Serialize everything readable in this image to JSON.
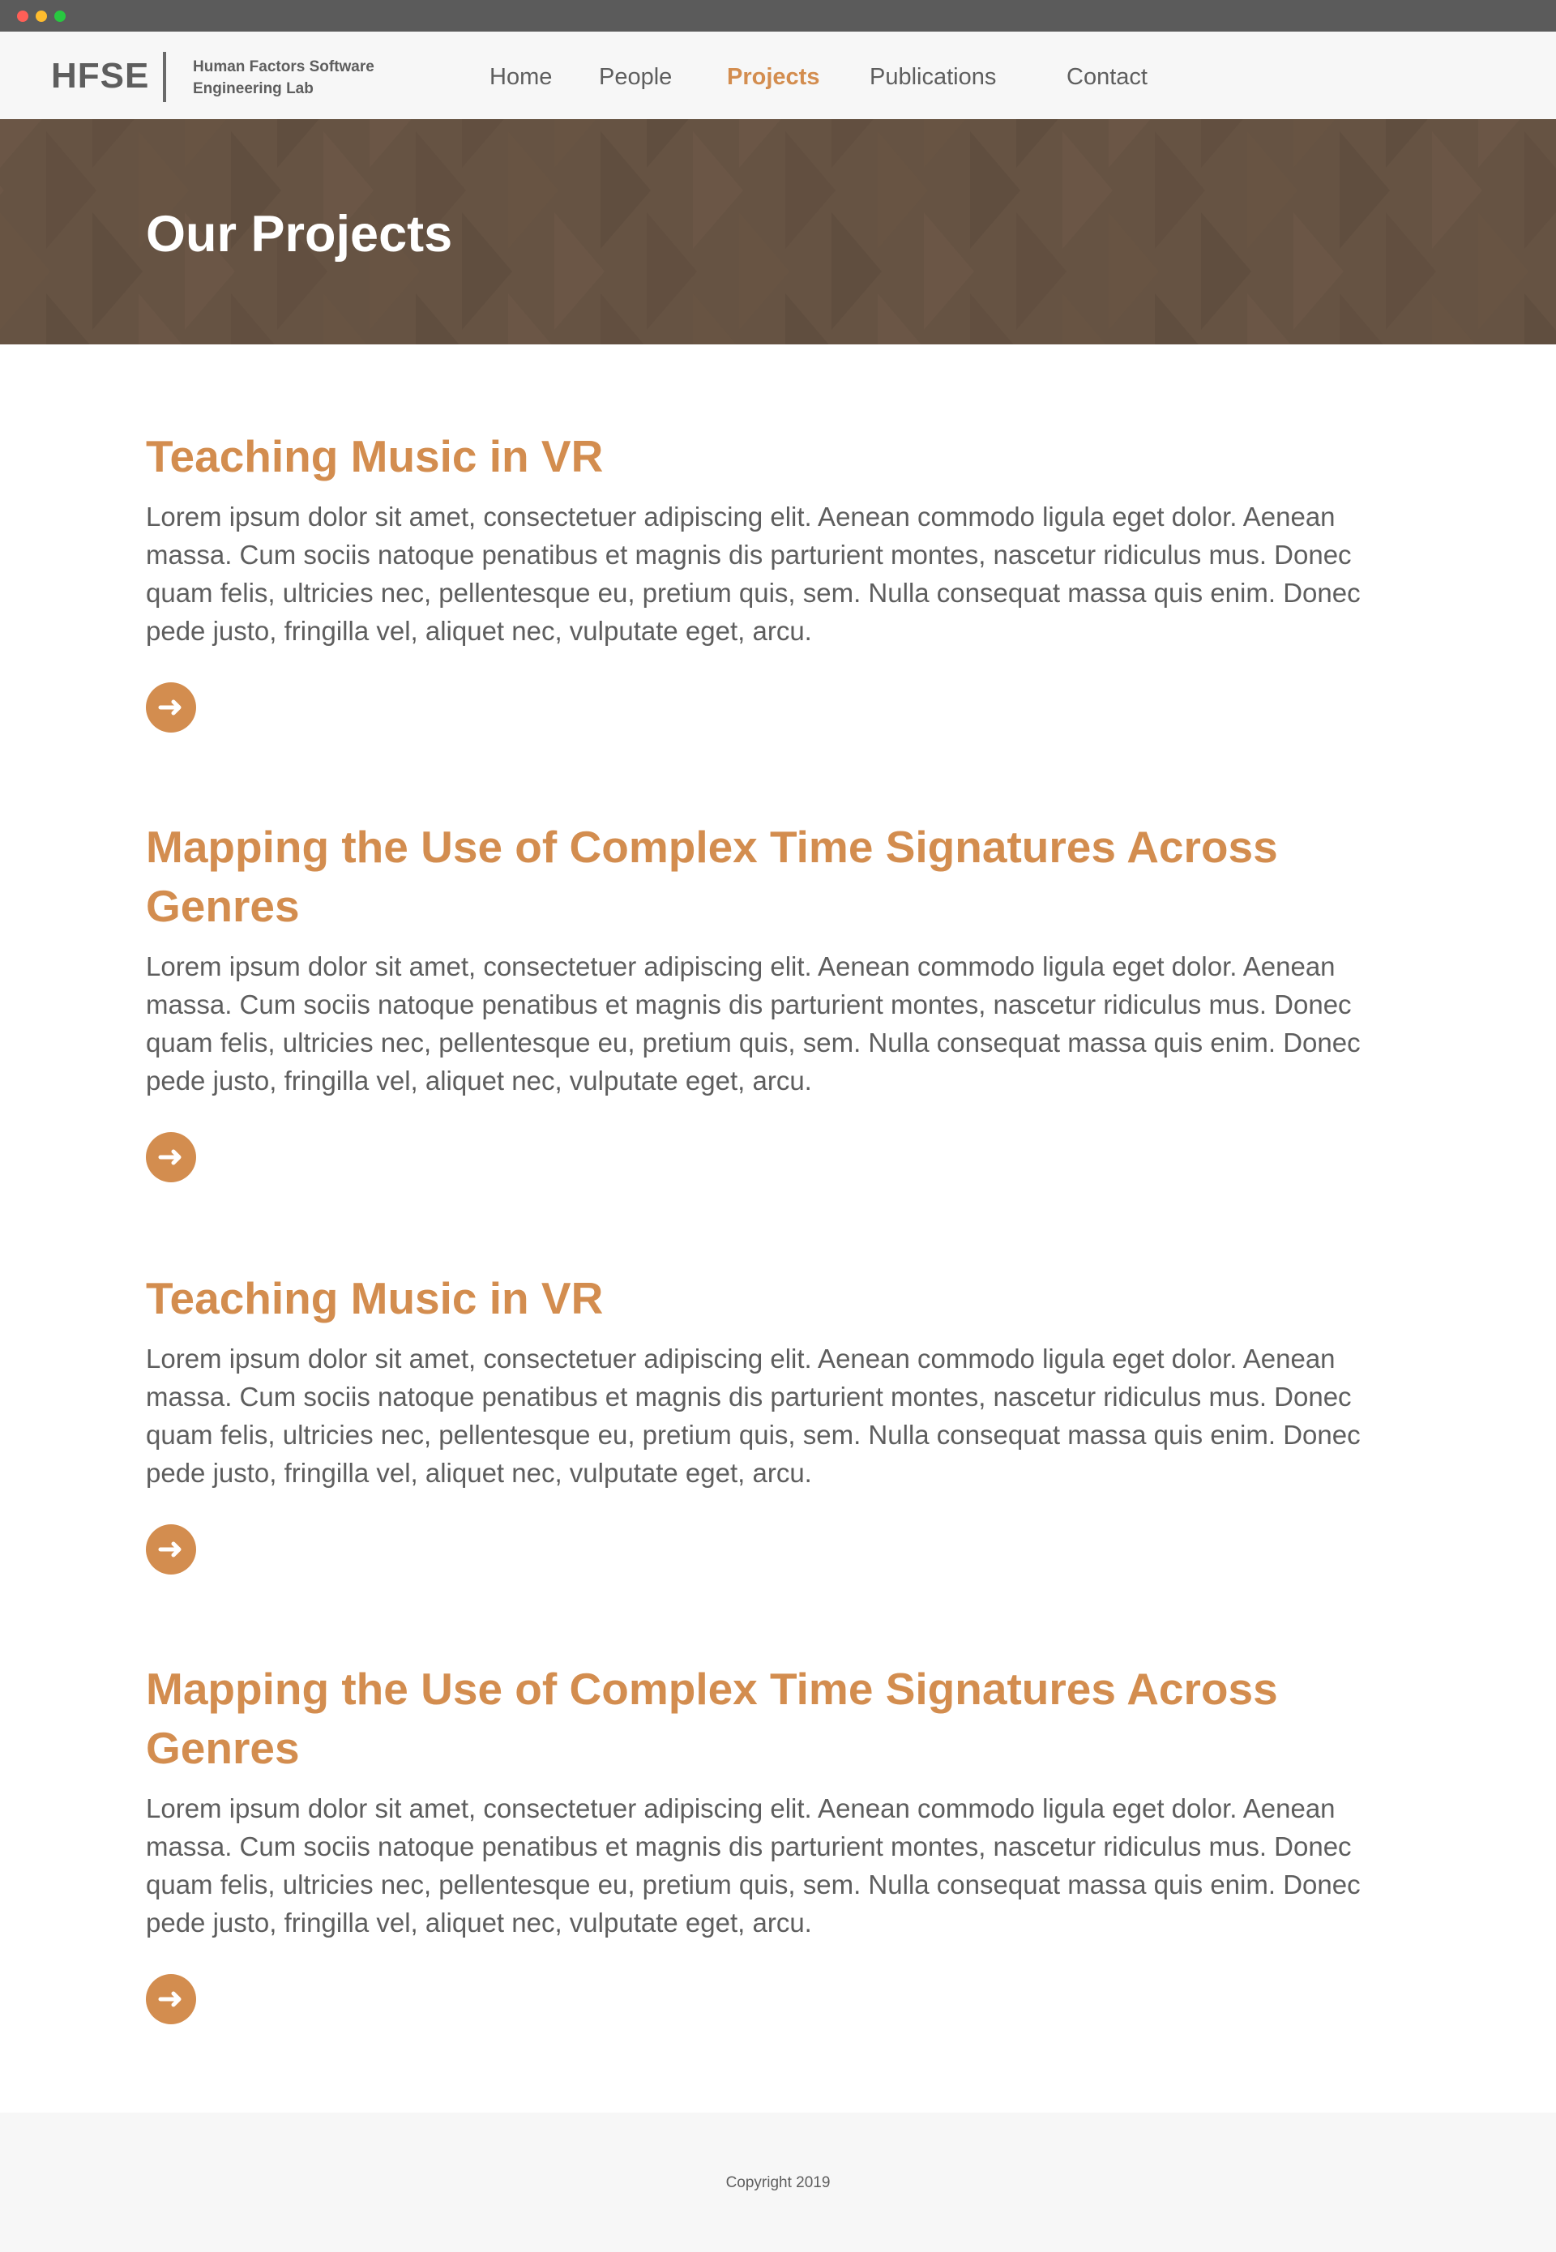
{
  "theme": {
    "accent": "#d38d4f",
    "text": "#5e5e5e",
    "hero_bg": "#665343",
    "window_dots": [
      "#ff5f57",
      "#febc2e",
      "#28c840"
    ]
  },
  "header": {
    "logo": "HFSE",
    "lab_name": "Human Factors Software Engineering Lab",
    "nav": [
      {
        "label": "Home",
        "active": false
      },
      {
        "label": "People",
        "active": false
      },
      {
        "label": "Projects",
        "active": true
      },
      {
        "label": "Publications",
        "active": false
      },
      {
        "label": "Contact",
        "active": false
      }
    ]
  },
  "hero": {
    "title": "Our Projects"
  },
  "projects": [
    {
      "title": "Teaching Music in VR",
      "description": "Lorem ipsum dolor sit amet, consectetuer adipiscing elit. Aenean commodo  ligula eget dolor. Aenean massa. Cum sociis natoque penatibus et magnis dis parturient montes, nascetur ridiculus mus. Donec quam felis, ultricies nec, pellentesque eu, pretium quis, sem. Nulla consequat massa quis enim. Donec pede justo, fringilla vel, aliquet nec, vulputate eget, arcu.",
      "button_icon": "arrow-right-icon"
    },
    {
      "title": "Mapping the Use of Complex Time Signatures Across Genres",
      "description": "Lorem ipsum dolor sit amet, consectetuer adipiscing elit. Aenean commodo  ligula eget dolor. Aenean massa. Cum sociis natoque penatibus et magnis dis parturient montes, nascetur ridiculus mus. Donec quam felis, ultricies nec, pellentesque eu, pretium quis, sem. Nulla consequat massa quis enim. Donec pede justo, fringilla vel, aliquet nec, vulputate eget, arcu.",
      "button_icon": "arrow-right-icon"
    },
    {
      "title": "Teaching Music in VR",
      "description": "Lorem ipsum dolor sit amet, consectetuer adipiscing elit. Aenean commodo  ligula eget dolor. Aenean massa. Cum sociis natoque penatibus et magnis dis parturient montes, nascetur ridiculus mus. Donec quam felis, ultricies nec, pellentesque eu, pretium quis, sem. Nulla consequat massa quis enim. Donec pede justo, fringilla vel, aliquet nec, vulputate eget, arcu.",
      "button_icon": "arrow-right-icon"
    },
    {
      "title": "Mapping the Use of Complex Time Signatures Across Genres",
      "description": "Lorem ipsum dolor sit amet, consectetuer adipiscing elit. Aenean commodo  ligula eget dolor. Aenean massa. Cum sociis natoque penatibus et magnis dis parturient montes, nascetur ridiculus mus. Donec quam felis, ultricies nec, pellentesque eu, pretium quis, sem. Nulla consequat massa quis enim. Donec pede justo, fringilla vel, aliquet nec, vulputate eget, arcu.",
      "button_icon": "arrow-right-icon"
    }
  ],
  "footer": {
    "copyright": "Copyright 2019"
  }
}
